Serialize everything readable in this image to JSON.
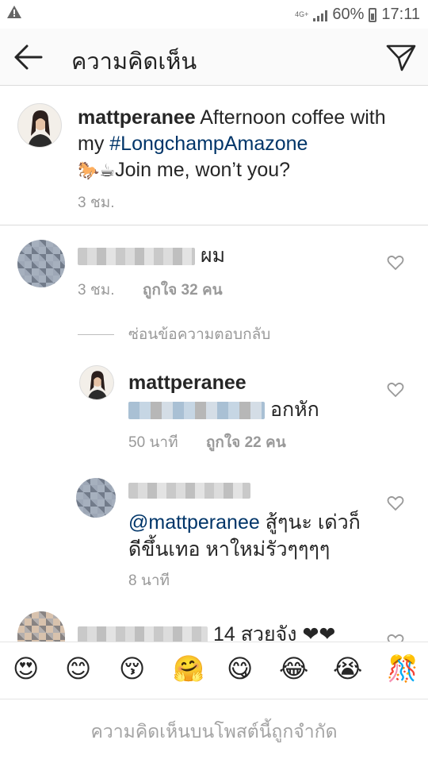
{
  "status_bar": {
    "network": "4G+",
    "battery": "60%",
    "time": "17:11"
  },
  "header": {
    "title": "ความคิดเห็น"
  },
  "caption": {
    "username": "mattperanee",
    "text_before": " Afternoon coffee with my ",
    "hashtag": "#LongchampAmazone",
    "emojis": "🐎☕",
    "text_after": "Join me, won’t you?",
    "time": "3 ชม."
  },
  "comments": [
    {
      "text": "ผม",
      "time": "3 ชม.",
      "likes": "ถูกใจ 32 คน",
      "hide_replies": "ซ่อนข้อความตอบกลับ"
    }
  ],
  "replies": [
    {
      "username": "mattperanee",
      "text": "อกหัก",
      "time": "50 นาที",
      "likes": "ถูกใจ 22 คน"
    },
    {
      "mention": "@mattperanee",
      "text_line1": " สู้ๆนะ เด่วก็",
      "text_line2": "ดีขึ้นเทอ หาใหม่รัวๆๆๆๆ",
      "time": "8 นาที"
    }
  ],
  "partial_comment": {
    "text": "14 สวยจัง ❤❤"
  },
  "emoji_bar": [
    "😍",
    "😊",
    "😚",
    "🤗",
    "😋",
    "😂",
    "😭",
    "🎊"
  ],
  "footer": {
    "restricted_text": "ความคิดเห็นบนโพสต์นี้ถูกจำกัด"
  },
  "colors": {
    "hashtag": "#003569",
    "meta": "#999999",
    "divider": "#dbdbdb"
  }
}
